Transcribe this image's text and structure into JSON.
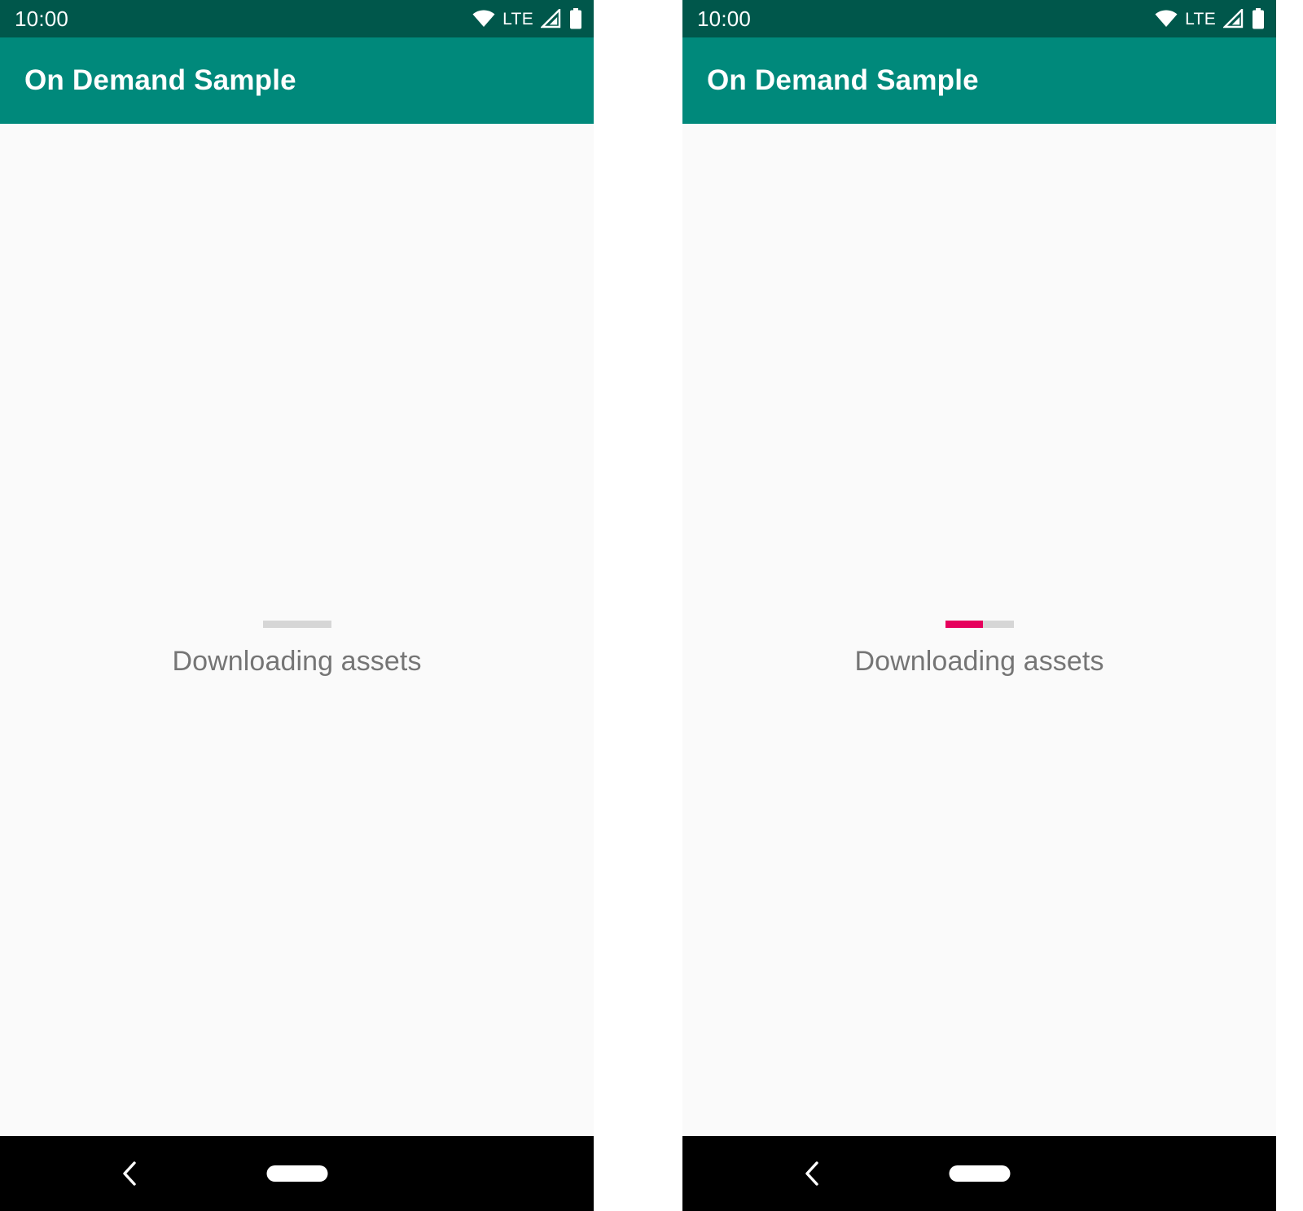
{
  "screens": [
    {
      "id": "left",
      "status_bar": {
        "time": "10:00",
        "network_label": "LTE",
        "icons": [
          "wifi-icon",
          "cellular-signal-icon",
          "battery-icon"
        ]
      },
      "app_bar": {
        "title": "On Demand Sample"
      },
      "content": {
        "progress": {
          "value": 0,
          "max": 100,
          "percent_label": "0%",
          "track_color": "#d6d6d6",
          "fill_color": "#E6005C"
        },
        "label": "Downloading assets"
      },
      "nav_bar": {
        "back_label": "Back",
        "home_label": "Home"
      }
    },
    {
      "id": "right",
      "status_bar": {
        "time": "10:00",
        "network_label": "LTE",
        "icons": [
          "wifi-icon",
          "cellular-signal-icon",
          "battery-icon"
        ]
      },
      "app_bar": {
        "title": "On Demand Sample"
      },
      "content": {
        "progress": {
          "value": 55,
          "max": 100,
          "percent_label": "55%",
          "track_color": "#d6d6d6",
          "fill_color": "#E6005C"
        },
        "label": "Downloading assets"
      },
      "nav_bar": {
        "back_label": "Back",
        "home_label": "Home"
      }
    }
  ],
  "theme": {
    "status_bar_color": "#00574B",
    "app_bar_color": "#00897B",
    "background_color": "#fafafa",
    "nav_bar_color": "#000000",
    "accent_color": "#E6005C",
    "text_secondary": "#757575"
  }
}
